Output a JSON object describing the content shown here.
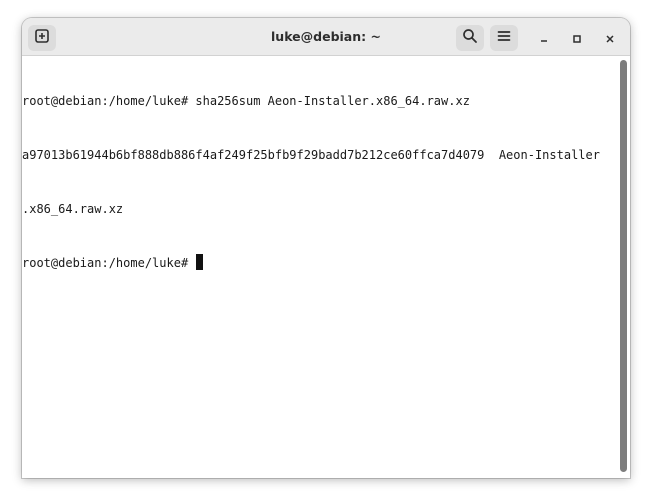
{
  "window": {
    "title": "luke@debian: ~"
  },
  "headerbar": {
    "new_tab_icon": "new-tab-icon",
    "search_icon": "search-icon",
    "menu_icon": "hamburger-menu-icon",
    "minimize_icon": "minimize-icon",
    "maximize_icon": "maximize-icon",
    "close_icon": "close-icon"
  },
  "terminal": {
    "lines": [
      "root@debian:/home/luke# sha256sum Aeon-Installer.x86_64.raw.xz",
      "a97013b61944b6bf888db886f4af249f25bfb9f29badd7b212ce60ffca7d4079  Aeon-Installer",
      ".x86_64.raw.xz",
      "root@debian:/home/luke# "
    ]
  },
  "colors": {
    "headerbar_bg": "#ebebeb",
    "terminal_bg": "#ffffff",
    "text": "#1a1a1a",
    "scrollbar": "#7d7d7d"
  }
}
